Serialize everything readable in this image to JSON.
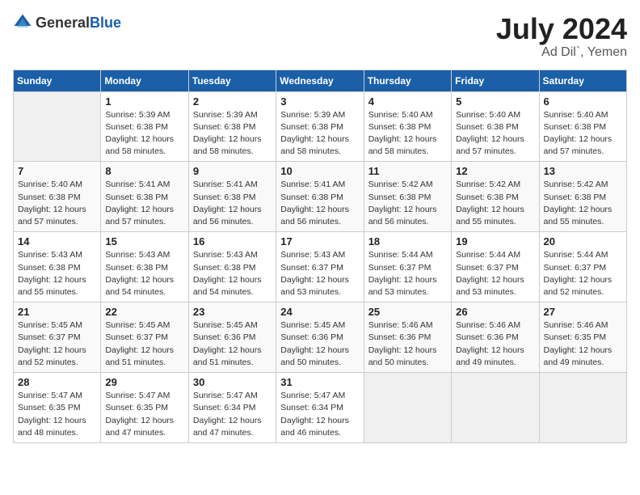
{
  "header": {
    "logo_general": "General",
    "logo_blue": "Blue",
    "month_year": "July 2024",
    "location": "Ad Dil`, Yemen"
  },
  "weekdays": [
    "Sunday",
    "Monday",
    "Tuesday",
    "Wednesday",
    "Thursday",
    "Friday",
    "Saturday"
  ],
  "weeks": [
    [
      {
        "day": null
      },
      {
        "day": "1",
        "sunrise": "5:39 AM",
        "sunset": "6:38 PM",
        "daylight": "12 hours and 58 minutes."
      },
      {
        "day": "2",
        "sunrise": "5:39 AM",
        "sunset": "6:38 PM",
        "daylight": "12 hours and 58 minutes."
      },
      {
        "day": "3",
        "sunrise": "5:39 AM",
        "sunset": "6:38 PM",
        "daylight": "12 hours and 58 minutes."
      },
      {
        "day": "4",
        "sunrise": "5:40 AM",
        "sunset": "6:38 PM",
        "daylight": "12 hours and 58 minutes."
      },
      {
        "day": "5",
        "sunrise": "5:40 AM",
        "sunset": "6:38 PM",
        "daylight": "12 hours and 57 minutes."
      },
      {
        "day": "6",
        "sunrise": "5:40 AM",
        "sunset": "6:38 PM",
        "daylight": "12 hours and 57 minutes."
      }
    ],
    [
      {
        "day": "7",
        "sunrise": "5:40 AM",
        "sunset": "6:38 PM",
        "daylight": "12 hours and 57 minutes."
      },
      {
        "day": "8",
        "sunrise": "5:41 AM",
        "sunset": "6:38 PM",
        "daylight": "12 hours and 57 minutes."
      },
      {
        "day": "9",
        "sunrise": "5:41 AM",
        "sunset": "6:38 PM",
        "daylight": "12 hours and 56 minutes."
      },
      {
        "day": "10",
        "sunrise": "5:41 AM",
        "sunset": "6:38 PM",
        "daylight": "12 hours and 56 minutes."
      },
      {
        "day": "11",
        "sunrise": "5:42 AM",
        "sunset": "6:38 PM",
        "daylight": "12 hours and 56 minutes."
      },
      {
        "day": "12",
        "sunrise": "5:42 AM",
        "sunset": "6:38 PM",
        "daylight": "12 hours and 55 minutes."
      },
      {
        "day": "13",
        "sunrise": "5:42 AM",
        "sunset": "6:38 PM",
        "daylight": "12 hours and 55 minutes."
      }
    ],
    [
      {
        "day": "14",
        "sunrise": "5:43 AM",
        "sunset": "6:38 PM",
        "daylight": "12 hours and 55 minutes."
      },
      {
        "day": "15",
        "sunrise": "5:43 AM",
        "sunset": "6:38 PM",
        "daylight": "12 hours and 54 minutes."
      },
      {
        "day": "16",
        "sunrise": "5:43 AM",
        "sunset": "6:38 PM",
        "daylight": "12 hours and 54 minutes."
      },
      {
        "day": "17",
        "sunrise": "5:43 AM",
        "sunset": "6:37 PM",
        "daylight": "12 hours and 53 minutes."
      },
      {
        "day": "18",
        "sunrise": "5:44 AM",
        "sunset": "6:37 PM",
        "daylight": "12 hours and 53 minutes."
      },
      {
        "day": "19",
        "sunrise": "5:44 AM",
        "sunset": "6:37 PM",
        "daylight": "12 hours and 53 minutes."
      },
      {
        "day": "20",
        "sunrise": "5:44 AM",
        "sunset": "6:37 PM",
        "daylight": "12 hours and 52 minutes."
      }
    ],
    [
      {
        "day": "21",
        "sunrise": "5:45 AM",
        "sunset": "6:37 PM",
        "daylight": "12 hours and 52 minutes."
      },
      {
        "day": "22",
        "sunrise": "5:45 AM",
        "sunset": "6:37 PM",
        "daylight": "12 hours and 51 minutes."
      },
      {
        "day": "23",
        "sunrise": "5:45 AM",
        "sunset": "6:36 PM",
        "daylight": "12 hours and 51 minutes."
      },
      {
        "day": "24",
        "sunrise": "5:45 AM",
        "sunset": "6:36 PM",
        "daylight": "12 hours and 50 minutes."
      },
      {
        "day": "25",
        "sunrise": "5:46 AM",
        "sunset": "6:36 PM",
        "daylight": "12 hours and 50 minutes."
      },
      {
        "day": "26",
        "sunrise": "5:46 AM",
        "sunset": "6:36 PM",
        "daylight": "12 hours and 49 minutes."
      },
      {
        "day": "27",
        "sunrise": "5:46 AM",
        "sunset": "6:35 PM",
        "daylight": "12 hours and 49 minutes."
      }
    ],
    [
      {
        "day": "28",
        "sunrise": "5:47 AM",
        "sunset": "6:35 PM",
        "daylight": "12 hours and 48 minutes."
      },
      {
        "day": "29",
        "sunrise": "5:47 AM",
        "sunset": "6:35 PM",
        "daylight": "12 hours and 47 minutes."
      },
      {
        "day": "30",
        "sunrise": "5:47 AM",
        "sunset": "6:34 PM",
        "daylight": "12 hours and 47 minutes."
      },
      {
        "day": "31",
        "sunrise": "5:47 AM",
        "sunset": "6:34 PM",
        "daylight": "12 hours and 46 minutes."
      },
      {
        "day": null
      },
      {
        "day": null
      },
      {
        "day": null
      }
    ]
  ]
}
